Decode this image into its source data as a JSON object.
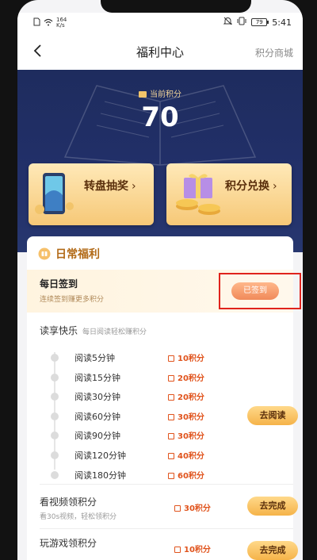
{
  "status_bar": {
    "speed_value": "164",
    "speed_unit": "K/s",
    "battery": "79",
    "time": "5:41"
  },
  "nav": {
    "title": "福利中心",
    "right_link": "积分商城",
    "back_icon": "chevron-left-icon"
  },
  "hero": {
    "points_label": "当前积分",
    "points_value": "70",
    "cards": [
      {
        "label": "转盘抽奖",
        "icon": "phone-prize-icon"
      },
      {
        "label": "积分兑换",
        "icon": "gift-coins-icon"
      }
    ]
  },
  "daily": {
    "title": "日常福利",
    "checkin": {
      "title": "每日签到",
      "subtitle": "连续签到赚更多积分",
      "button": "已签到"
    },
    "reading": {
      "title": "读享快乐",
      "subtitle": "每日阅读轻松赚积分",
      "items": [
        {
          "name": "阅读5分钟",
          "points": "10积分"
        },
        {
          "name": "阅读15分钟",
          "points": "20积分"
        },
        {
          "name": "阅读30分钟",
          "points": "20积分"
        },
        {
          "name": "阅读60分钟",
          "points": "30积分"
        },
        {
          "name": "阅读90分钟",
          "points": "30积分"
        },
        {
          "name": "阅读120分钟",
          "points": "40积分"
        },
        {
          "name": "阅读180分钟",
          "points": "60积分"
        }
      ],
      "button": "去阅读"
    },
    "video": {
      "title": "看视频领积分",
      "subtitle": "看30s视频，轻松领积分",
      "points": "30积分",
      "button": "去完成"
    },
    "game": {
      "title": "玩游戏领积分",
      "points": "10积分",
      "button": "去完成"
    }
  },
  "colors": {
    "hero_bg": "#1e2c5e",
    "accent_orange": "#e0531c",
    "gold": "#f5b349",
    "highlight_red": "#e0231c"
  }
}
